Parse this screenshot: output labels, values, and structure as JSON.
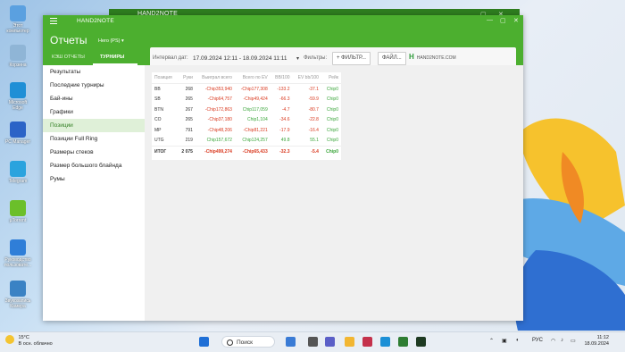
{
  "desktop": {
    "icons": [
      {
        "label": "Этот компьютер",
        "color": "#5aa0e0"
      },
      {
        "label": "Корзина",
        "color": "#8fb5d6"
      },
      {
        "label": "Microsoft Edge",
        "color": "#1f8fd6"
      },
      {
        "label": "PC Manager",
        "color": "#2b63c7"
      },
      {
        "label": "Telegram",
        "color": "#2aa3de"
      },
      {
        "label": "µTorrent",
        "color": "#6bbf2a"
      },
      {
        "label": "Руководство пользовате...",
        "color": "#2f7ed8"
      },
      {
        "label": "Звукозапись Камера",
        "color": "#3a82c4"
      }
    ]
  },
  "back_window": {
    "title": "HAND2NOTE"
  },
  "window": {
    "app_title": "HAND2NOTE",
    "page_title": "Отчеты",
    "hero": "Hero (PS)",
    "tabs": [
      "КЭШ ОТЧЕТЫ",
      "ТУРНИРЫ"
    ],
    "active_tab": "ТУРНИРЫ",
    "toolbar": {
      "interval_label": "Интервал дат:",
      "date_range": "17.09.2024 12:11 - 18.09.2024 11:11",
      "filters_label": "Фильтры:",
      "filter_button": "ФИЛЬТР...",
      "file_button": "ФАЙЛ...",
      "logo_text": "HAND2NOTE.COM"
    },
    "sidebar": [
      "Результаты",
      "Последние турниры",
      "Бай-ины",
      "Графики",
      "Позиции",
      "Позиции Full Ring",
      "Размеры стеков",
      "Размер большого блайнда",
      "Румы"
    ],
    "active_sidebar": "Позиции",
    "table": {
      "headers": [
        "Позиция",
        "Руки",
        "Выиграл всего",
        "Всего по EV",
        "BB/100",
        "EV bb/100",
        "Рейк"
      ],
      "rows": [
        {
          "pos": "BB",
          "hands": "268",
          "won": "-Chip353,940",
          "ev": "-Chip177,308",
          "bb": "-133.2",
          "evbb": "-37.1",
          "rake": "Chip0",
          "won_neg": true,
          "ev_neg": true,
          "bb_neg": true,
          "evbb_neg": true
        },
        {
          "pos": "SB",
          "hands": "265",
          "won": "-Chip64,757",
          "ev": "-Chip49,424",
          "bb": "-66.3",
          "evbb": "-59.9",
          "rake": "Chip0",
          "won_neg": true,
          "ev_neg": true,
          "bb_neg": true,
          "evbb_neg": true
        },
        {
          "pos": "BTN",
          "hands": "267",
          "won": "-Chip172,863",
          "ev": "Chip117,059",
          "bb": "-4.7",
          "evbb": "-80.7",
          "rake": "Chip0",
          "won_neg": true,
          "ev_neg": false,
          "bb_neg": true,
          "evbb_neg": true
        },
        {
          "pos": "CO",
          "hands": "265",
          "won": "-Chip37,180",
          "ev": "Chip1,104",
          "bb": "-34.6",
          "evbb": "-22.8",
          "rake": "Chip0",
          "won_neg": true,
          "ev_neg": false,
          "bb_neg": true,
          "evbb_neg": true
        },
        {
          "pos": "MP",
          "hands": "791",
          "won": "-Chip48,206",
          "ev": "-Chip81,221",
          "bb": "-17.9",
          "evbb": "-16.4",
          "rake": "Chip0",
          "won_neg": true,
          "ev_neg": true,
          "bb_neg": true,
          "evbb_neg": true
        },
        {
          "pos": "UTG",
          "hands": "219",
          "won": "Chip157,672",
          "ev": "Chip124,257",
          "bb": "49.8",
          "evbb": "55.1",
          "rake": "Chip0",
          "won_neg": false,
          "ev_neg": false,
          "bb_neg": false,
          "evbb_neg": false
        }
      ],
      "total": {
        "pos": "ИТОГ",
        "hands": "2 075",
        "won": "-Chip499,274",
        "ev": "-Chip65,433",
        "bb": "-32.3",
        "evbb": "-5.4",
        "rake": "Chip0"
      }
    }
  },
  "taskbar": {
    "weather_temp": "15°C",
    "weather_desc": "В осн. облачно",
    "search_placeholder": "Поиск",
    "lang": "РУС",
    "time": "11:12",
    "date": "18.09.2024"
  }
}
